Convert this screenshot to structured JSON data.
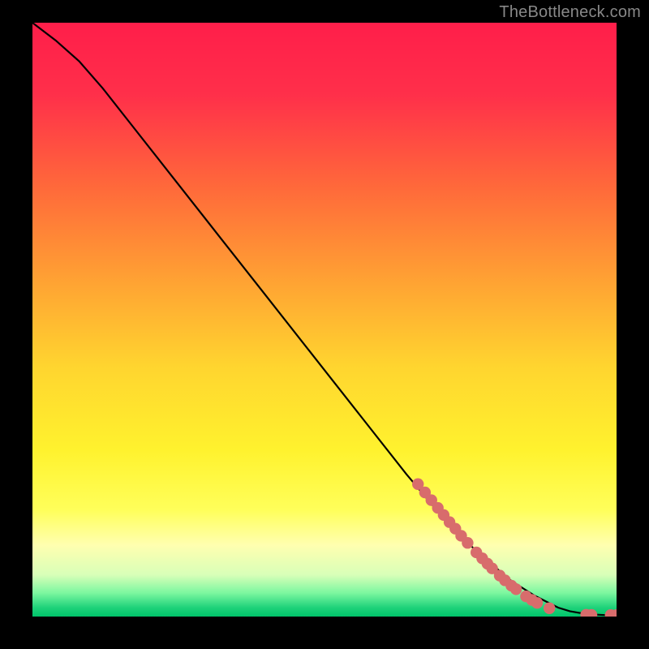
{
  "watermark": "TheBottleneck.com",
  "colors": {
    "gradient_stops": [
      {
        "offset": 0.0,
        "color": "#ff1e4a"
      },
      {
        "offset": 0.12,
        "color": "#ff2f4a"
      },
      {
        "offset": 0.28,
        "color": "#ff6a3a"
      },
      {
        "offset": 0.44,
        "color": "#ffa433"
      },
      {
        "offset": 0.58,
        "color": "#ffd52f"
      },
      {
        "offset": 0.72,
        "color": "#fff22e"
      },
      {
        "offset": 0.82,
        "color": "#ffff5a"
      },
      {
        "offset": 0.88,
        "color": "#ffffb0"
      },
      {
        "offset": 0.93,
        "color": "#d8ffb8"
      },
      {
        "offset": 0.96,
        "color": "#7df7a0"
      },
      {
        "offset": 0.985,
        "color": "#1ed27a"
      },
      {
        "offset": 1.0,
        "color": "#00c46a"
      }
    ],
    "curve": "#000000",
    "dots": "#d86c6c",
    "background": "#000000"
  },
  "chart_data": {
    "type": "line",
    "title": "",
    "xlabel": "",
    "ylabel": "",
    "xlim": [
      0,
      100
    ],
    "ylim": [
      0,
      100
    ],
    "grid": false,
    "series": [
      {
        "name": "curve",
        "x": [
          0,
          4,
          8,
          12,
          16,
          24,
          32,
          40,
          48,
          56,
          64,
          70,
          76,
          82,
          86,
          90,
          92,
          94,
          96,
          98,
          100
        ],
        "y": [
          100,
          97,
          93.5,
          89,
          84,
          74,
          64,
          54,
          44,
          34,
          24,
          17,
          11,
          6,
          3.5,
          1.5,
          0.9,
          0.55,
          0.35,
          0.25,
          0.25
        ]
      }
    ],
    "points": [
      {
        "x": 66,
        "y": 22.3
      },
      {
        "x": 67.2,
        "y": 20.9
      },
      {
        "x": 68.3,
        "y": 19.6
      },
      {
        "x": 69.4,
        "y": 18.3
      },
      {
        "x": 70.4,
        "y": 17.1
      },
      {
        "x": 71.4,
        "y": 15.9
      },
      {
        "x": 72.4,
        "y": 14.8
      },
      {
        "x": 73.4,
        "y": 13.6
      },
      {
        "x": 74.5,
        "y": 12.4
      },
      {
        "x": 76.0,
        "y": 10.8
      },
      {
        "x": 77.0,
        "y": 9.8
      },
      {
        "x": 77.9,
        "y": 8.9
      },
      {
        "x": 78.7,
        "y": 8.1
      },
      {
        "x": 80.0,
        "y": 6.9
      },
      {
        "x": 80.9,
        "y": 6.1
      },
      {
        "x": 82.0,
        "y": 5.2
      },
      {
        "x": 82.8,
        "y": 4.6
      },
      {
        "x": 84.5,
        "y": 3.4
      },
      {
        "x": 85.5,
        "y": 2.8
      },
      {
        "x": 86.4,
        "y": 2.3
      },
      {
        "x": 88.5,
        "y": 1.4
      },
      {
        "x": 94.8,
        "y": 0.3
      },
      {
        "x": 95.7,
        "y": 0.28
      },
      {
        "x": 99.0,
        "y": 0.25
      },
      {
        "x": 100.0,
        "y": 0.25
      }
    ]
  }
}
